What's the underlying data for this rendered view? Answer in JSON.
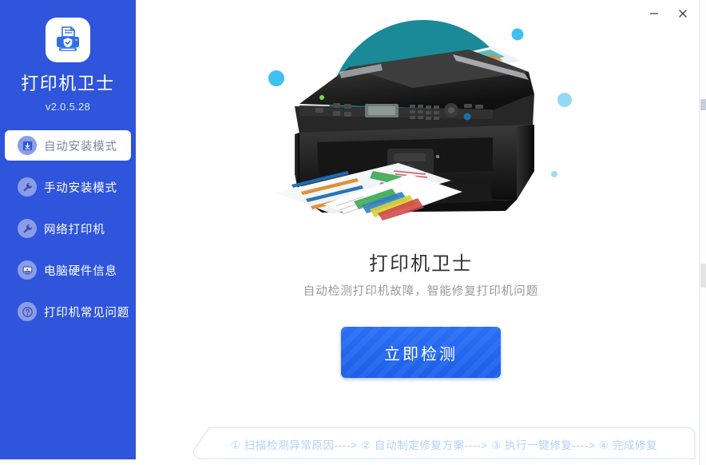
{
  "window": {
    "minimize_label": "—",
    "close_label": "✕"
  },
  "sidebar": {
    "app_name": "打印机卫士",
    "version": "v2.0.5.28",
    "logo_icon": "printer-shield-logo-icon",
    "background_color": "#2F55DC",
    "items": [
      {
        "label": "自动安装模式",
        "icon": "download-box-icon",
        "active": true
      },
      {
        "label": "手动安装模式",
        "icon": "wrench-icon",
        "active": false
      },
      {
        "label": "网络打印机",
        "icon": "wrench-icon",
        "active": false
      },
      {
        "label": "电脑硬件信息",
        "icon": "monitor-icon",
        "active": false
      },
      {
        "label": "打印机常见问题",
        "icon": "question-circle-icon",
        "active": false
      }
    ]
  },
  "main": {
    "illustration": {
      "name": "multifunction-printer-illustration",
      "circle_color": "#1A8A99",
      "dot_color": "#3FC0F0"
    },
    "headline": "打印机卫士",
    "subline": "自动检测打印机故障，智能修复打印机问题",
    "cta_label": "立即检测",
    "cta_color": "#2166EF",
    "stepbar": {
      "text": "① 扫描检测异常原因----> ② 自动制定修复方案----> ③ 执行一键修复----> ④ 完成修复",
      "border_color": "#D6E6FA",
      "text_color": "#B4D2F7"
    }
  }
}
